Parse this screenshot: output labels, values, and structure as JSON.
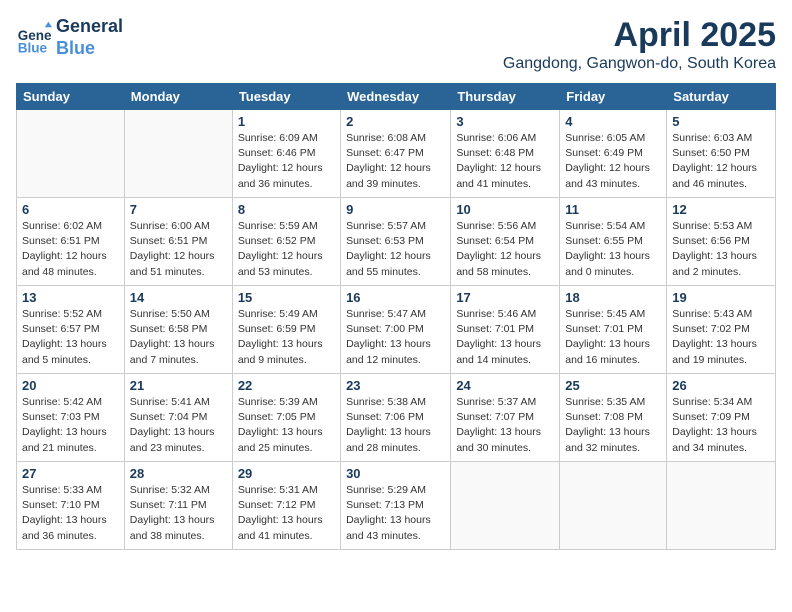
{
  "logo": {
    "line1": "General",
    "line2": "Blue"
  },
  "title": "April 2025",
  "subtitle": "Gangdong, Gangwon-do, South Korea",
  "weekdays": [
    "Sunday",
    "Monday",
    "Tuesday",
    "Wednesday",
    "Thursday",
    "Friday",
    "Saturday"
  ],
  "weeks": [
    [
      {
        "day": "",
        "info": ""
      },
      {
        "day": "",
        "info": ""
      },
      {
        "day": "1",
        "info": "Sunrise: 6:09 AM\nSunset: 6:46 PM\nDaylight: 12 hours and 36 minutes."
      },
      {
        "day": "2",
        "info": "Sunrise: 6:08 AM\nSunset: 6:47 PM\nDaylight: 12 hours and 39 minutes."
      },
      {
        "day": "3",
        "info": "Sunrise: 6:06 AM\nSunset: 6:48 PM\nDaylight: 12 hours and 41 minutes."
      },
      {
        "day": "4",
        "info": "Sunrise: 6:05 AM\nSunset: 6:49 PM\nDaylight: 12 hours and 43 minutes."
      },
      {
        "day": "5",
        "info": "Sunrise: 6:03 AM\nSunset: 6:50 PM\nDaylight: 12 hours and 46 minutes."
      }
    ],
    [
      {
        "day": "6",
        "info": "Sunrise: 6:02 AM\nSunset: 6:51 PM\nDaylight: 12 hours and 48 minutes."
      },
      {
        "day": "7",
        "info": "Sunrise: 6:00 AM\nSunset: 6:51 PM\nDaylight: 12 hours and 51 minutes."
      },
      {
        "day": "8",
        "info": "Sunrise: 5:59 AM\nSunset: 6:52 PM\nDaylight: 12 hours and 53 minutes."
      },
      {
        "day": "9",
        "info": "Sunrise: 5:57 AM\nSunset: 6:53 PM\nDaylight: 12 hours and 55 minutes."
      },
      {
        "day": "10",
        "info": "Sunrise: 5:56 AM\nSunset: 6:54 PM\nDaylight: 12 hours and 58 minutes."
      },
      {
        "day": "11",
        "info": "Sunrise: 5:54 AM\nSunset: 6:55 PM\nDaylight: 13 hours and 0 minutes."
      },
      {
        "day": "12",
        "info": "Sunrise: 5:53 AM\nSunset: 6:56 PM\nDaylight: 13 hours and 2 minutes."
      }
    ],
    [
      {
        "day": "13",
        "info": "Sunrise: 5:52 AM\nSunset: 6:57 PM\nDaylight: 13 hours and 5 minutes."
      },
      {
        "day": "14",
        "info": "Sunrise: 5:50 AM\nSunset: 6:58 PM\nDaylight: 13 hours and 7 minutes."
      },
      {
        "day": "15",
        "info": "Sunrise: 5:49 AM\nSunset: 6:59 PM\nDaylight: 13 hours and 9 minutes."
      },
      {
        "day": "16",
        "info": "Sunrise: 5:47 AM\nSunset: 7:00 PM\nDaylight: 13 hours and 12 minutes."
      },
      {
        "day": "17",
        "info": "Sunrise: 5:46 AM\nSunset: 7:01 PM\nDaylight: 13 hours and 14 minutes."
      },
      {
        "day": "18",
        "info": "Sunrise: 5:45 AM\nSunset: 7:01 PM\nDaylight: 13 hours and 16 minutes."
      },
      {
        "day": "19",
        "info": "Sunrise: 5:43 AM\nSunset: 7:02 PM\nDaylight: 13 hours and 19 minutes."
      }
    ],
    [
      {
        "day": "20",
        "info": "Sunrise: 5:42 AM\nSunset: 7:03 PM\nDaylight: 13 hours and 21 minutes."
      },
      {
        "day": "21",
        "info": "Sunrise: 5:41 AM\nSunset: 7:04 PM\nDaylight: 13 hours and 23 minutes."
      },
      {
        "day": "22",
        "info": "Sunrise: 5:39 AM\nSunset: 7:05 PM\nDaylight: 13 hours and 25 minutes."
      },
      {
        "day": "23",
        "info": "Sunrise: 5:38 AM\nSunset: 7:06 PM\nDaylight: 13 hours and 28 minutes."
      },
      {
        "day": "24",
        "info": "Sunrise: 5:37 AM\nSunset: 7:07 PM\nDaylight: 13 hours and 30 minutes."
      },
      {
        "day": "25",
        "info": "Sunrise: 5:35 AM\nSunset: 7:08 PM\nDaylight: 13 hours and 32 minutes."
      },
      {
        "day": "26",
        "info": "Sunrise: 5:34 AM\nSunset: 7:09 PM\nDaylight: 13 hours and 34 minutes."
      }
    ],
    [
      {
        "day": "27",
        "info": "Sunrise: 5:33 AM\nSunset: 7:10 PM\nDaylight: 13 hours and 36 minutes."
      },
      {
        "day": "28",
        "info": "Sunrise: 5:32 AM\nSunset: 7:11 PM\nDaylight: 13 hours and 38 minutes."
      },
      {
        "day": "29",
        "info": "Sunrise: 5:31 AM\nSunset: 7:12 PM\nDaylight: 13 hours and 41 minutes."
      },
      {
        "day": "30",
        "info": "Sunrise: 5:29 AM\nSunset: 7:13 PM\nDaylight: 13 hours and 43 minutes."
      },
      {
        "day": "",
        "info": ""
      },
      {
        "day": "",
        "info": ""
      },
      {
        "day": "",
        "info": ""
      }
    ]
  ]
}
